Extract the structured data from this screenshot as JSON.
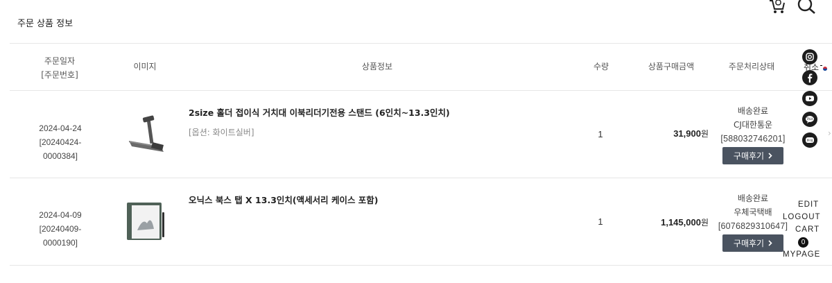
{
  "section": {
    "title": "주문 상품 정보"
  },
  "header": {
    "col_date_l1": "주문일자",
    "col_date_l2": "[주문번호]",
    "col_image": "이미지",
    "col_product": "상품정보",
    "col_qty": "수량",
    "col_amount": "상품구매금액",
    "col_status": "주문처리상태",
    "col_cancel": "취소"
  },
  "orders": [
    {
      "date": "2024-04-24",
      "order_no": "[20240424-0000384]",
      "product_name": "2size 홀더 접이식 거치대 이북리더기전용 스탠드 (6인치~13.3인치)",
      "option": "[옵션: 화이트실버]",
      "qty": "1",
      "price": "31,900",
      "currency": "원",
      "status": "배송완료",
      "carrier": "CJ대한통운",
      "tracking": "[588032746201]",
      "review_label": "구매후기"
    },
    {
      "date": "2024-04-09",
      "order_no": "[20240409-0000190]",
      "product_name": "오닉스 북스 탭 X 13.3인치(액세서리 케이스 포함)",
      "option": "",
      "qty": "1",
      "price": "1,145,000",
      "currency": "원",
      "status": "배송완료",
      "carrier": "우체국택배",
      "tracking": "[6076829310647]",
      "review_label": "구매후기"
    }
  ],
  "quick_menu": {
    "edit": "EDIT",
    "logout": "LOGOUT",
    "cart": "CART",
    "cart_count": "0",
    "mypage": "MYPAGE"
  },
  "social_icons": [
    "instagram-icon",
    "facebook-icon",
    "youtube-icon",
    "talk-icon",
    "blog-icon"
  ],
  "top_icons": [
    "cart-icon",
    "search-icon"
  ],
  "colors": {
    "button_bg": "#4a5360",
    "divider": "#e6e6e6"
  }
}
